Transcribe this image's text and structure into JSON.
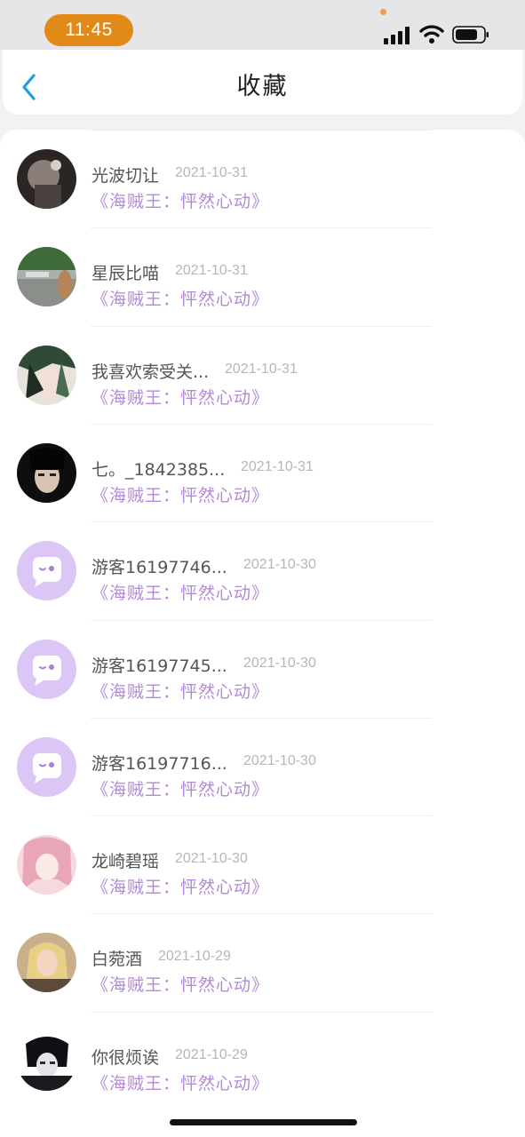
{
  "status_bar": {
    "time": "11:45"
  },
  "header": {
    "title": "收藏"
  },
  "favorites": [
    {
      "user": "光波切让",
      "date": "2021-10-31",
      "book": "《海贼王：怦然心动》",
      "avatar": "photo-dark"
    },
    {
      "user": "星辰比喵",
      "date": "2021-10-31",
      "book": "《海贼王：怦然心动》",
      "avatar": "photo-landscape"
    },
    {
      "user": "我喜欢索受关...",
      "date": "2021-10-31",
      "book": "《海贼王：怦然心动》",
      "avatar": "anime-green"
    },
    {
      "user": "七。_1842385...",
      "date": "2021-10-31",
      "book": "《海贼王：怦然心动》",
      "avatar": "anime-dark"
    },
    {
      "user": "游客16197746...",
      "date": "2021-10-30",
      "book": "《海贼王：怦然心动》",
      "avatar": "default-chat-icon"
    },
    {
      "user": "游客16197745...",
      "date": "2021-10-30",
      "book": "《海贼王：怦然心动》",
      "avatar": "default-chat-icon"
    },
    {
      "user": "游客16197716...",
      "date": "2021-10-30",
      "book": "《海贼王：怦然心动》",
      "avatar": "default-chat-icon"
    },
    {
      "user": "龙崎碧瑶",
      "date": "2021-10-30",
      "book": "《海贼王：怦然心动》",
      "avatar": "anime-pink"
    },
    {
      "user": "白菀酒",
      "date": "2021-10-29",
      "book": "《海贼王：怦然心动》",
      "avatar": "photo-blonde"
    },
    {
      "user": "你很烦诶",
      "date": "2021-10-29",
      "book": "《海贼王：怦然心动》",
      "avatar": "anime-mono"
    }
  ],
  "colors": {
    "accent": "#1e9be9",
    "book_title": "#b28ad6",
    "time_pill": "#e28a17",
    "default_avatar": "#dcc6f6"
  }
}
